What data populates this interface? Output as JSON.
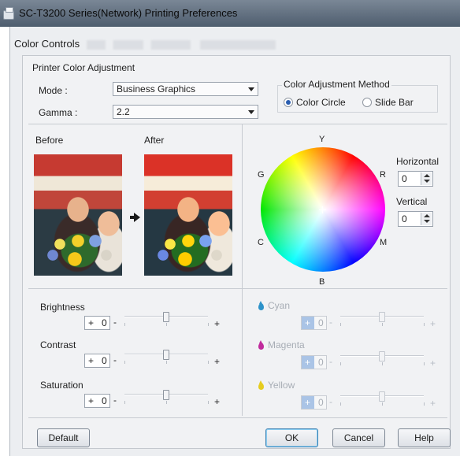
{
  "window": {
    "title": "SC-T3200 Series(Network) Printing Preferences",
    "icon": "printer-icon"
  },
  "dialog": {
    "caption": "Color Controls"
  },
  "printer_color_adjustment": {
    "group_title": "Printer Color Adjustment",
    "mode_label": "Mode :",
    "mode_value": "Business Graphics",
    "gamma_label": "Gamma :",
    "gamma_value": "2.2"
  },
  "color_adjustment_method": {
    "title": "Color Adjustment Method",
    "options": [
      {
        "label": "Color Circle",
        "selected": true
      },
      {
        "label": "Slide Bar",
        "selected": false
      }
    ]
  },
  "preview": {
    "before_label": "Before",
    "after_label": "After"
  },
  "color_circle": {
    "labels": {
      "top": "Y",
      "upper_left": "G",
      "upper_right": "R",
      "lower_left": "C",
      "lower_right": "M",
      "bottom": "B"
    },
    "horizontal_label": "Horizontal",
    "horizontal_value": "0",
    "vertical_label": "Vertical",
    "vertical_value": "0"
  },
  "adjustments": [
    {
      "label": "Brightness",
      "sign": "+",
      "value": "0",
      "level": 0,
      "minus": "-",
      "plus": "+"
    },
    {
      "label": "Contrast",
      "sign": "+",
      "value": "0",
      "level": 0,
      "minus": "-",
      "plus": "+"
    },
    {
      "label": "Saturation",
      "sign": "+",
      "value": "0",
      "level": 0,
      "minus": "-",
      "plus": "+"
    }
  ],
  "ink_adjustments": [
    {
      "label": "Cyan",
      "sign": "+",
      "value": "0",
      "icon": "cyan-drop-icon",
      "minus": "-",
      "plus": "+",
      "enabled": false
    },
    {
      "label": "Magenta",
      "sign": "+",
      "value": "0",
      "icon": "magenta-drop-icon",
      "minus": "-",
      "plus": "+",
      "enabled": false
    },
    {
      "label": "Yellow",
      "sign": "+",
      "value": "0",
      "icon": "yellow-drop-icon",
      "minus": "-",
      "plus": "+",
      "enabled": false
    }
  ],
  "buttons": {
    "default": "Default",
    "ok": "OK",
    "cancel": "Cancel",
    "help": "Help"
  },
  "colors": {
    "accent": "#2a5db0",
    "cyan": "#2d92c9",
    "magenta": "#c02a9c",
    "yellow": "#e6cc1e"
  }
}
